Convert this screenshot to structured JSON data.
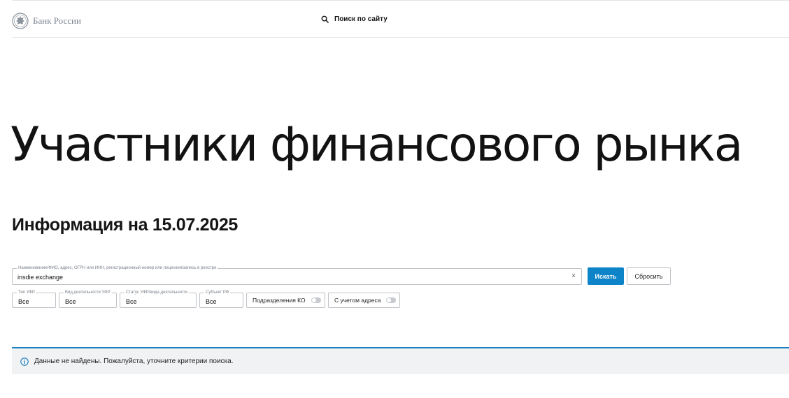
{
  "header": {
    "logo_text": "Банк России",
    "site_search_label": "Поиск по сайту"
  },
  "page": {
    "title": "Участники финансового рынка",
    "info_date": "Информация на 15.07.2025"
  },
  "search": {
    "legend": "Наименование/ФИО, адрес, ОГРН или ИНН, регистрационный номер или лицензия/запись в реестре",
    "value": "insdie exchange",
    "clear_glyph": "×",
    "submit_label": "Искать",
    "reset_label": "Сбросить"
  },
  "filters": {
    "type": {
      "legend": "Тип УФР",
      "value": "Все"
    },
    "activity": {
      "legend": "Вид деятельности УФР",
      "value": "Все"
    },
    "status": {
      "legend": "Статус УФР/вида деятельности",
      "value": "Все"
    },
    "region": {
      "legend": "Субъект РФ",
      "value": "Все"
    }
  },
  "toggles": {
    "divisions": {
      "label": "Подразделения КО",
      "on": false
    },
    "address": {
      "label": "С учетом адреса",
      "on": false
    }
  },
  "notice": {
    "text": "Данные не найдены. Пожалуйста, уточните критерии поиска."
  },
  "colors": {
    "accent": "#0d84c8",
    "notice_border": "#1a7fbf",
    "notice_bg": "#f0f2f3"
  },
  "icons": {
    "logo": "bank-emblem-icon",
    "site_search": "search-icon",
    "notice": "info-icon"
  }
}
